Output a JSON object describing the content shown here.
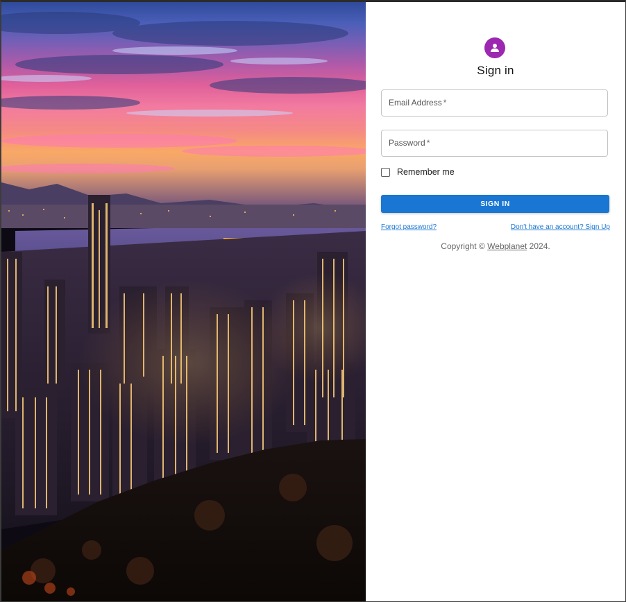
{
  "hero": {
    "icon": "city-skyline-night-photo"
  },
  "signin": {
    "avatar_icon": "person-icon",
    "avatar_color": "#9c27b0",
    "title": "Sign in",
    "email": {
      "label": "Email Address",
      "required_mark": "*",
      "value": ""
    },
    "password": {
      "label": "Password",
      "required_mark": "*",
      "value": ""
    },
    "remember": {
      "label": "Remember me",
      "checked": false
    },
    "submit_label": "SIGN IN",
    "accent_color": "#1976d2",
    "forgot_link": "Forgot password?",
    "signup_link": "Don't have an account? Sign Up",
    "copyright": {
      "prefix": "Copyright ©",
      "brand": "Webplanet",
      "suffix": "2024."
    }
  }
}
